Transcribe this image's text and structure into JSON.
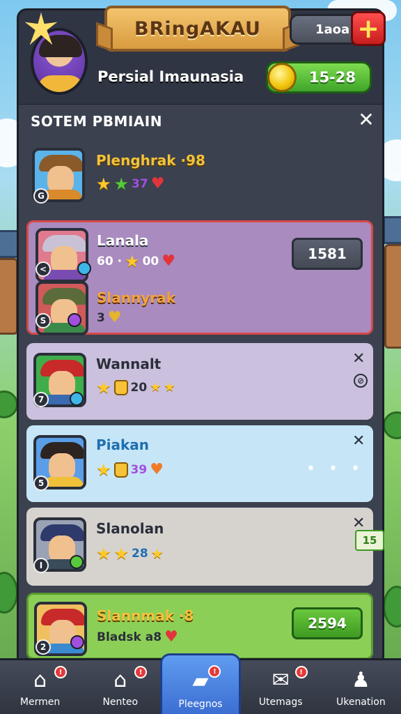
{
  "header": {
    "banner_title": "BRingAKAU",
    "player_name": "Persial Imaunasia",
    "level_label": "1aoa",
    "coins": "15-28",
    "plus_symbol": "+"
  },
  "panel": {
    "title": "SOTEM PBMIAIN",
    "close_symbol": "✕"
  },
  "cards": [
    {
      "name": "Plenghrak ·98",
      "stats_text": "37",
      "badge": "G"
    },
    {
      "name": "Lanala",
      "stats_prefix": "60 ·",
      "stats_text": "00",
      "score": "1581",
      "badge": "<"
    },
    {
      "name": "Slannyrak",
      "stats_text": "3",
      "badge": "S"
    },
    {
      "name": "Wannalt",
      "stats_text": "20",
      "badge": "7"
    },
    {
      "name": "Piakan",
      "stats_text": "39",
      "badge": "5",
      "dots": "• • •"
    },
    {
      "name": "Slanolan",
      "stats_text": "28",
      "badge": "I",
      "tag": "15"
    },
    {
      "name": "Slannmak ·8",
      "stats_text": "Bladsk a8",
      "score": "2594",
      "badge": "2"
    }
  ],
  "bottom_nav": [
    {
      "label": "Mermen",
      "icon": "home-icon",
      "glyph": "⌂",
      "badge": "!"
    },
    {
      "label": "Nenteo",
      "icon": "shop-icon",
      "glyph": "⌂",
      "badge": "!"
    },
    {
      "label": "Pleegnos",
      "icon": "card-icon",
      "glyph": "▰",
      "badge": "!"
    },
    {
      "label": "Utemags",
      "icon": "mail-icon",
      "glyph": "✉",
      "badge": "!"
    },
    {
      "label": "Ukenation",
      "icon": "profile-icon",
      "glyph": "♟",
      "badge": ""
    }
  ],
  "colors": {
    "accent_red": "#d94848",
    "coin_green": "#3fa52a",
    "panel_dark": "#3b414f",
    "active_tab": "#3a6cd0"
  }
}
